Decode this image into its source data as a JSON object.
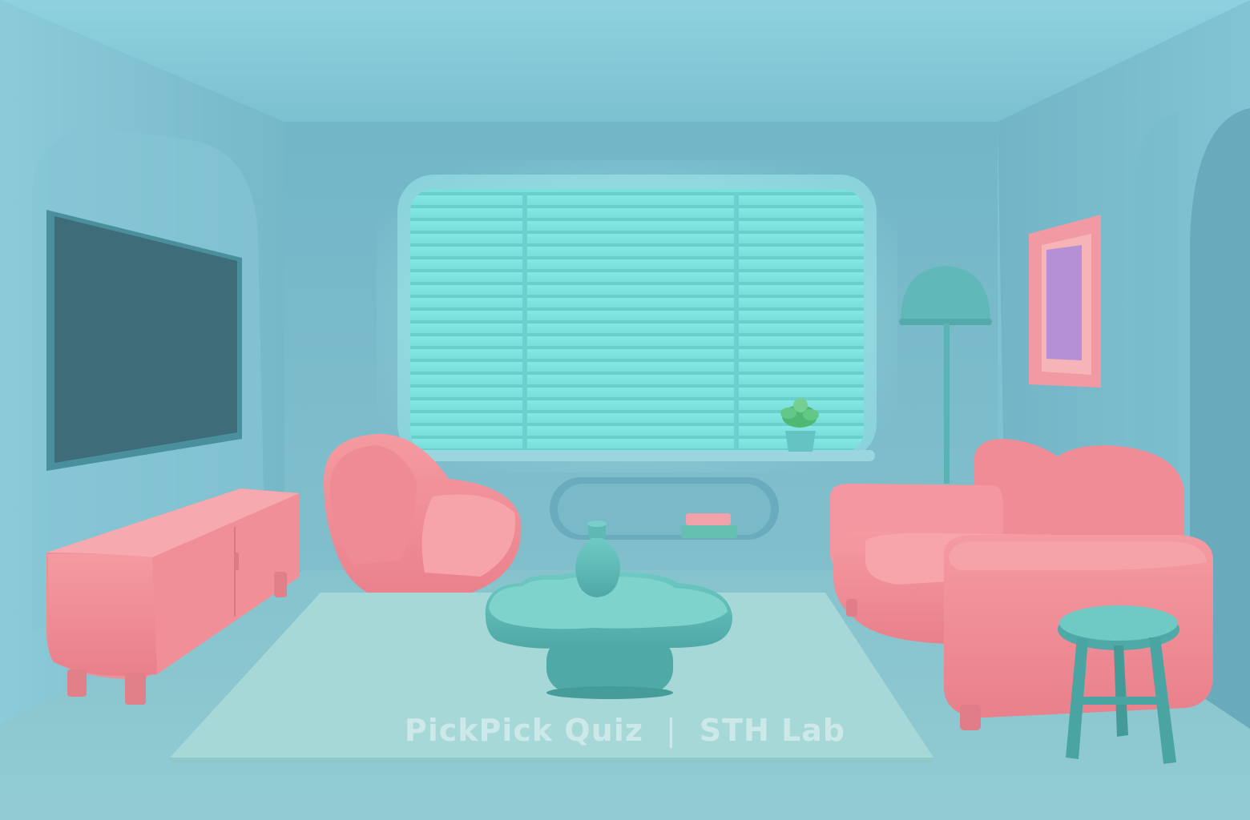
{
  "scene": {
    "description_type": "3d-rendered-living-room",
    "colors": {
      "wall": "#7cc0d0",
      "ceiling": "#86cad8",
      "floor": "#8fc7cf",
      "blinds": "#7fe3df",
      "furniture_pink": "#f28b94",
      "furniture_teal": "#5fb9b4",
      "tv_screen": "#3f6f7a",
      "rug": "#a3d6d6",
      "artwork_inner": "#b58fd6"
    }
  },
  "watermark": {
    "left": "PickPick Quiz",
    "separator": "|",
    "right": "STH Lab"
  }
}
